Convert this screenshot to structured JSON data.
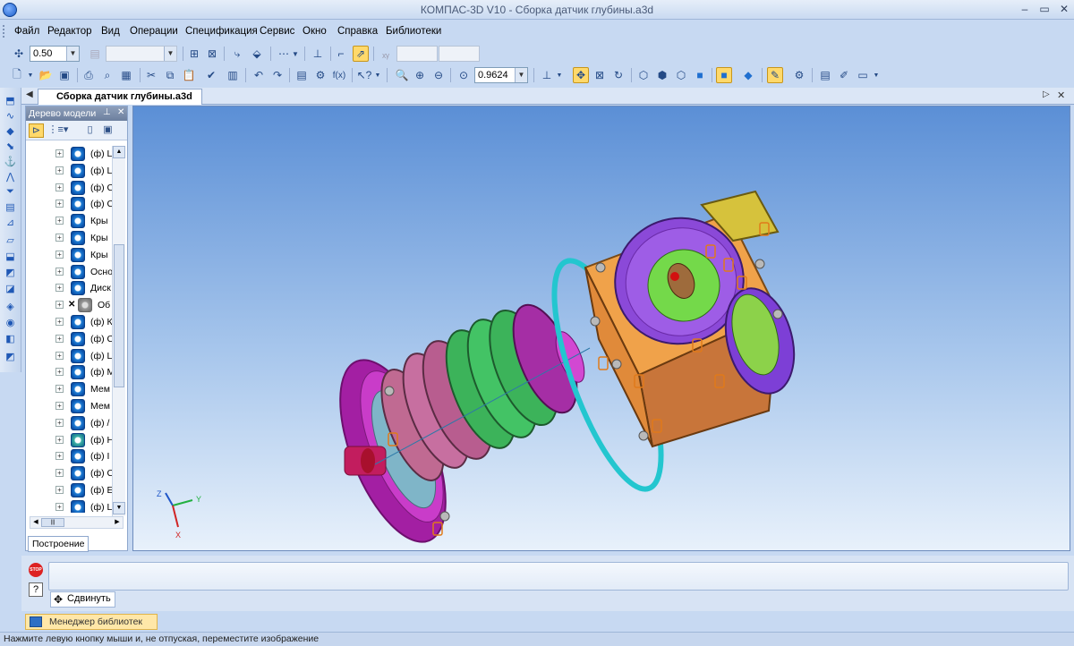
{
  "window": {
    "title": "КОМПАС-3D V10 - Сборка датчик глубины.a3d"
  },
  "menu": [
    "Файл",
    "Редактор",
    "Вид",
    "Операции",
    "Спецификация",
    "Сервис",
    "Окно",
    "Справка",
    "Библиотеки"
  ],
  "toolbar1": {
    "step_value": "0.50"
  },
  "toolbar2": {
    "zoom_value": "0.9624"
  },
  "document_tab": "Сборка датчик глубины.a3d",
  "tree": {
    "title": "Дерево модели",
    "items": [
      {
        "label": "(ф) L",
        "state": "ok"
      },
      {
        "label": "(ф) L",
        "state": "ok"
      },
      {
        "label": "(ф) С",
        "state": "ok"
      },
      {
        "label": "(ф) С",
        "state": "ok"
      },
      {
        "label": "Кры",
        "state": "ok"
      },
      {
        "label": "Кры",
        "state": "ok"
      },
      {
        "label": "Кры",
        "state": "ok"
      },
      {
        "label": "Осно",
        "state": "ok"
      },
      {
        "label": "Диск",
        "state": "ok"
      },
      {
        "label": "Об",
        "state": "error"
      },
      {
        "label": "(ф) К",
        "state": "ok"
      },
      {
        "label": "(ф) С",
        "state": "ok"
      },
      {
        "label": "(ф) L",
        "state": "ok"
      },
      {
        "label": "(ф) М",
        "state": "ok"
      },
      {
        "label": "Мем",
        "state": "ok"
      },
      {
        "label": "Мем",
        "state": "ok"
      },
      {
        "label": "(ф) /",
        "state": "ok"
      },
      {
        "label": "(ф) Н",
        "state": "alt"
      },
      {
        "label": "(ф) I",
        "state": "ok"
      },
      {
        "label": "(ф) С",
        "state": "ok"
      },
      {
        "label": "(ф) Е",
        "state": "ok"
      },
      {
        "label": "(ф) L",
        "state": "ok"
      }
    ],
    "footer_tab": "Построение"
  },
  "axes": {
    "z": "Z",
    "y": "Y",
    "x": "X"
  },
  "command": {
    "name": "Сдвинуть",
    "stop": "STOP"
  },
  "library_manager": "Менеджер библиотек",
  "status": "Нажмите левую кнопку мыши и, не отпуская, переместите изображение"
}
